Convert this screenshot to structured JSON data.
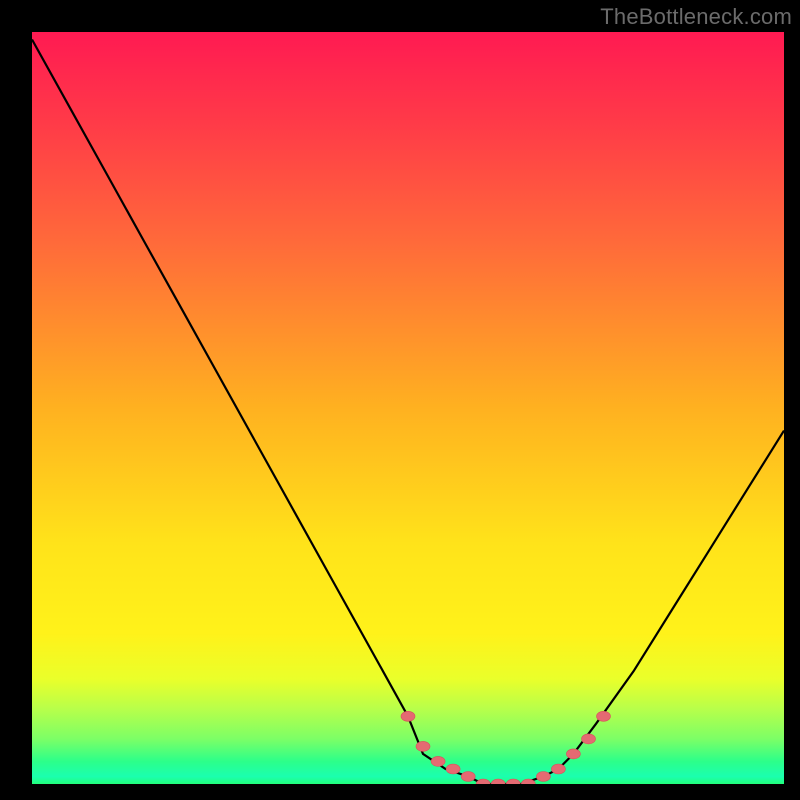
{
  "watermark": "TheBottleneck.com",
  "chart_data": {
    "type": "line",
    "title": "",
    "xlabel": "",
    "ylabel": "",
    "xlim": [
      0,
      100
    ],
    "ylim": [
      0,
      100
    ],
    "x": [
      0,
      5,
      10,
      15,
      20,
      25,
      30,
      35,
      40,
      45,
      50,
      52,
      55,
      58,
      60,
      62,
      65,
      68,
      70,
      72,
      75,
      80,
      85,
      90,
      95,
      100
    ],
    "values": [
      99,
      90,
      81,
      72,
      63,
      54,
      45,
      36,
      27,
      18,
      9,
      4,
      2,
      1,
      0,
      0,
      0,
      1,
      2,
      4,
      8,
      15,
      23,
      31,
      39,
      47
    ],
    "annotations": {
      "highlight_points_x": [
        50,
        52,
        54,
        56,
        58,
        60,
        62,
        64,
        66,
        68,
        70,
        72,
        74,
        76
      ],
      "highlight_points_y": [
        9,
        5,
        3,
        2,
        1,
        0,
        0,
        0,
        0,
        1,
        2,
        4,
        6,
        9
      ]
    },
    "colors": {
      "curve": "#000000",
      "points": "#e46a72",
      "background_top": "#ff1a52",
      "background_mid": "#ffe31a",
      "background_bottom": "#21ff7a"
    }
  }
}
